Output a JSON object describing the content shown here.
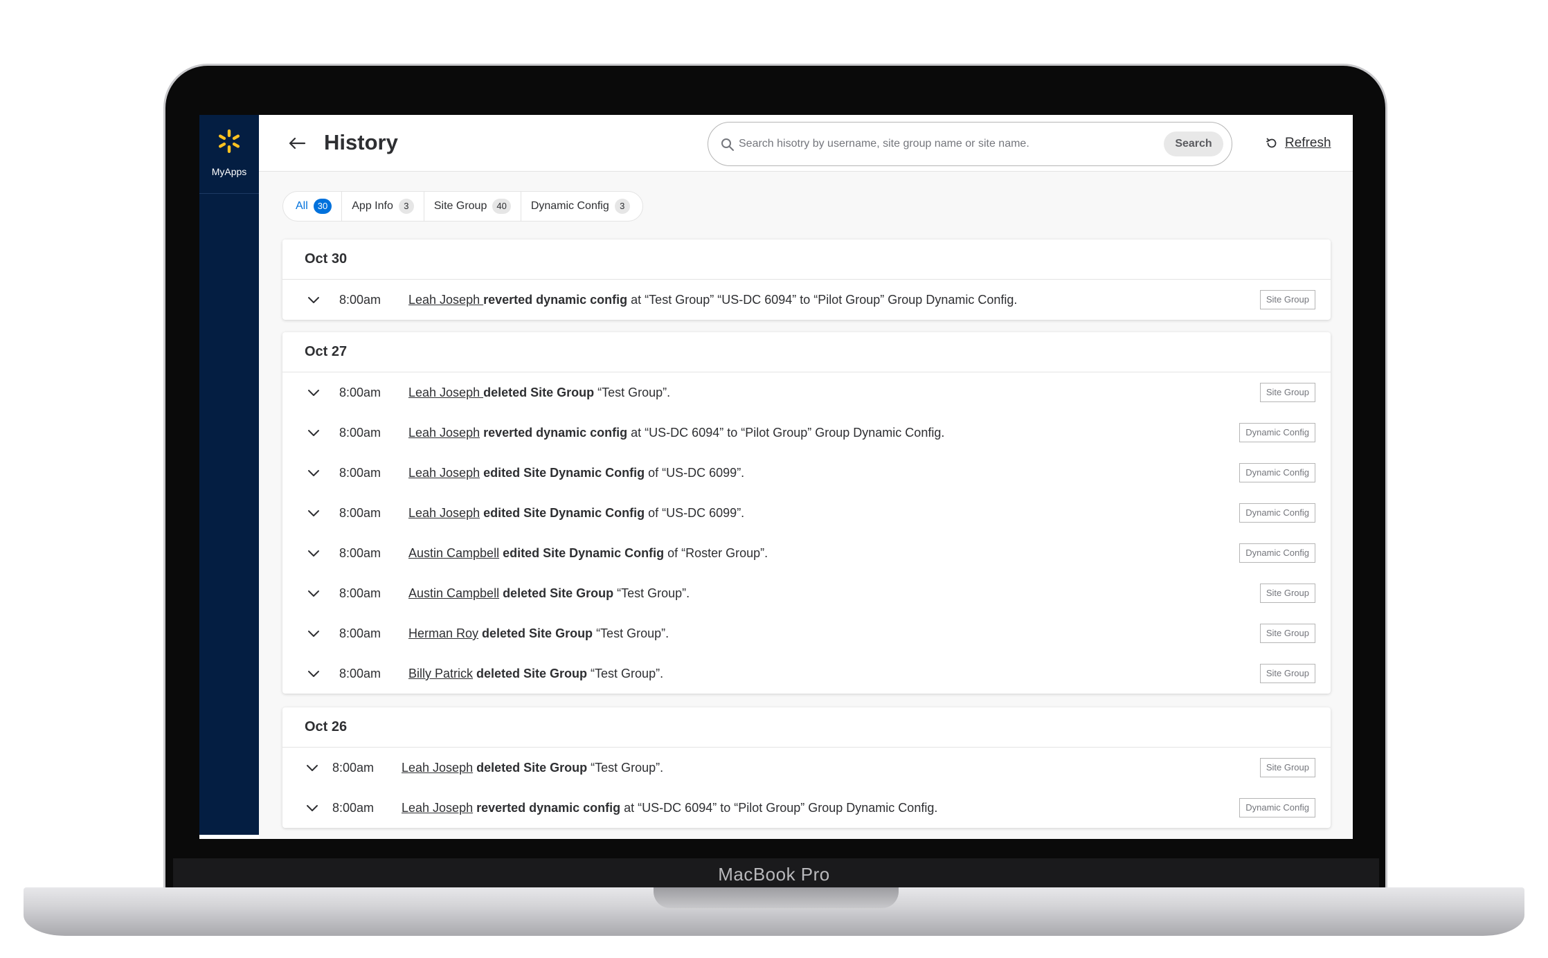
{
  "device": {
    "model_label": "MacBook Pro"
  },
  "sidebar": {
    "brand_label": "MyApps",
    "brand_color": "#ffc220",
    "background": "#041e42"
  },
  "header": {
    "title": "History",
    "search_placeholder": "Search hisotry by username, site group name or site name.",
    "search_button": "Search",
    "refresh_label": "Refresh"
  },
  "tabs": [
    {
      "label": "All",
      "count": "30",
      "active": true
    },
    {
      "label": "App Info",
      "count": "3"
    },
    {
      "label": "Site Group",
      "count": "40"
    },
    {
      "label": "Dynamic Config",
      "count": "3"
    }
  ],
  "groups": [
    {
      "date": "Oct 30",
      "entries": [
        {
          "time": "8:00am",
          "user": "Leah Joseph ",
          "action": "reverted dynamic config",
          "detail": " at  “Test Group” “US-DC 6094” to “Pilot Group” Group Dynamic Config.",
          "badge": "Site Group"
        }
      ]
    },
    {
      "date": "Oct 27",
      "entries": [
        {
          "time": "8:00am",
          "user": "Leah Joseph ",
          "action": "deleted Site Group",
          "detail": " “Test Group”.",
          "badge": "Site Group"
        },
        {
          "time": "8:00am",
          "user": "Leah Joseph",
          "action": " reverted dynamic config",
          "detail": " at “US-DC 6094” to “Pilot Group” Group Dynamic Config.",
          "badge": "Dynamic Config"
        },
        {
          "time": "8:00am",
          "user": "Leah Joseph",
          "action": " edited Site Dynamic Config",
          "detail": " of “US-DC 6099”.",
          "badge": "Dynamic Config"
        },
        {
          "time": "8:00am",
          "user": "Leah Joseph",
          "action": " edited Site Dynamic Config",
          "detail": " of “US-DC 6099”.",
          "badge": "Dynamic Config"
        },
        {
          "time": "8:00am",
          "user": "Austin Campbell",
          "action": " edited Site Dynamic Config",
          "detail": " of “Roster Group”.",
          "badge": "Dynamic Config"
        },
        {
          "time": "8:00am",
          "user": "Austin Campbell",
          "action": " deleted Site Group",
          "detail": " “Test Group”.",
          "badge": "Site Group"
        },
        {
          "time": "8:00am",
          "user": "Herman Roy",
          "action": " deleted Site Group",
          "detail": " “Test Group”.",
          "badge": "Site Group"
        },
        {
          "time": "8:00am",
          "user": "Billy Patrick",
          "action": " deleted Site Group",
          "detail": " “Test Group”.",
          "badge": "Site Group"
        }
      ]
    },
    {
      "date": "Oct 26",
      "entries": [
        {
          "time": "8:00am",
          "user": "Leah Joseph",
          "action": " deleted Site Group",
          "detail": " “Test Group”.",
          "badge": "Site Group"
        },
        {
          "time": "8:00am",
          "user": "Leah Joseph",
          "action": " reverted dynamic config",
          "detail": " at “US-DC 6094” to “Pilot Group” Group Dynamic Config.",
          "badge": "Dynamic Config"
        }
      ]
    }
  ]
}
